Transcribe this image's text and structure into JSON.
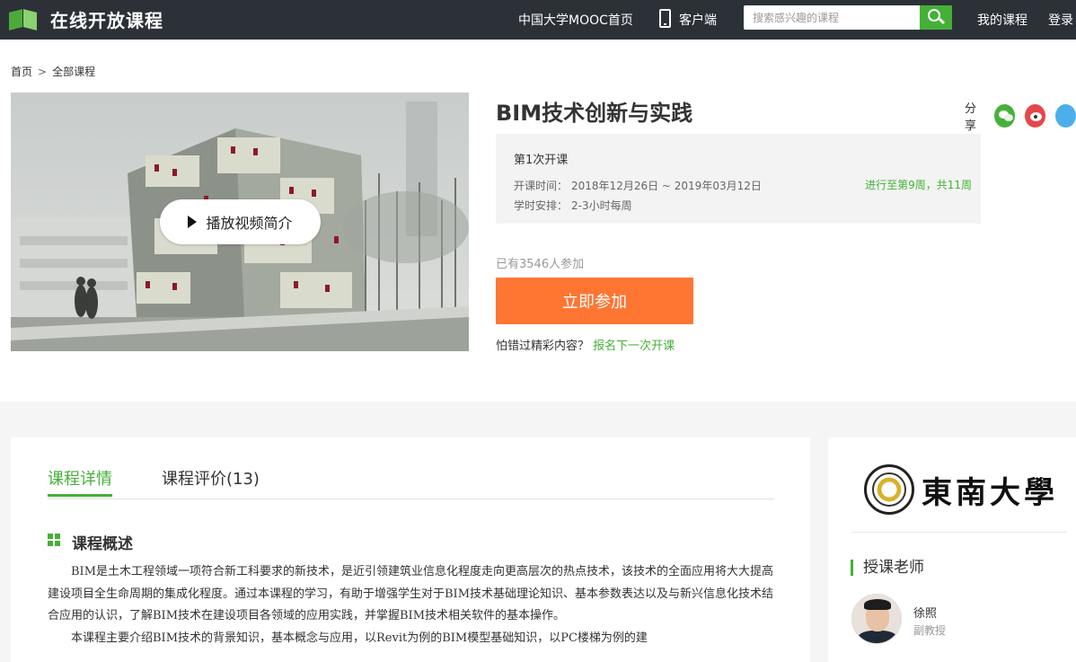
{
  "header": {
    "logo_text": "在线开放课程",
    "nav_mooc": "中国大学MOOC首页",
    "nav_client": "客户端",
    "search_placeholder": "搜索感兴趣的课程",
    "nav_my_courses": "我的课程",
    "nav_login": "登录",
    "colors": {
      "bar": "#2c3138",
      "accent": "#45b037"
    }
  },
  "breadcrumb": {
    "home": "首页",
    "separator": ">",
    "current": "全部课程"
  },
  "video": {
    "play_label": "播放视频简介"
  },
  "course": {
    "title": "BIM技术创新与实践",
    "share_label": "分享",
    "term": {
      "name": "第1次开课",
      "time_label": "开课时间：",
      "time_value": "2018年12月26日 ~ 2019年03月12日",
      "schedule_label": "学时安排：",
      "schedule_value": "2-3小时每周",
      "progress": "进行至第9周，共11周"
    },
    "enrolled": "已有3546人参加",
    "join_button": "立即参加",
    "miss_text": "怕错过精彩内容？",
    "miss_link": "报名下一次开课",
    "colors": {
      "join": "#ff7532"
    }
  },
  "detail": {
    "tabs": [
      {
        "label": "课程详情"
      },
      {
        "label": "课程评价(13)"
      }
    ],
    "section_title": "课程概述",
    "paragraphs": [
      "BIM是土木工程领域一项符合新工科要求的新技术，是近引领建筑业信息化程度走向更高层次的热点技术，该技术的全面应用将大大提高建设项目全生命周期的集成化程度。通过本课程的学习，有助于增强学生对于BIM技术基础理论知识、基本参数表达以及与新兴信息化技术结合应用的认识，了解BIM技术在建设项目各领域的应用实践，并掌握BIM技术相关软件的基本操作。",
      "本课程主要介绍BIM技术的背景知识，基本概念与应用，以Revit为例的BIM模型基础知识，以PC楼梯为例的建"
    ]
  },
  "side": {
    "university": "東南大學",
    "teacher_heading": "授课老师",
    "teacher": {
      "name": "徐照",
      "title": "副教授"
    }
  }
}
